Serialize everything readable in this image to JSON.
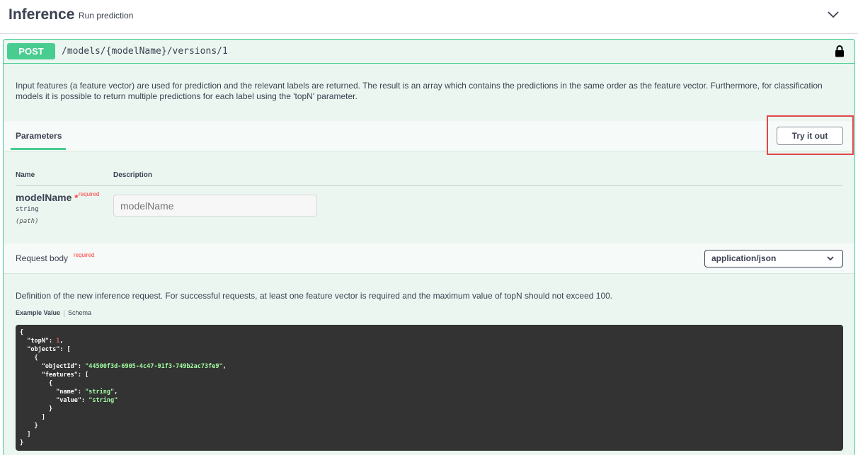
{
  "tag": {
    "title": "Inference",
    "description": "Run prediction"
  },
  "operation": {
    "method": "POST",
    "path": "/models/{modelName}/versions/1",
    "description": "Input features (a feature vector) are used for prediction and the relevant labels are returned. The result is an array which contains the predictions in the same order as the feature vector. Furthermore, for classification models it is possible to return multiple predictions for each label using the 'topN' parameter."
  },
  "parameters": {
    "tab_label": "Parameters",
    "try_label": "Try it out",
    "col_name": "Name",
    "col_description": "Description",
    "items": [
      {
        "name": "modelName",
        "star": "*",
        "required": "required",
        "type": "string",
        "in": "(path)",
        "placeholder": "modelName"
      }
    ]
  },
  "request_body": {
    "title": "Request body",
    "required": "required",
    "content_type": "application/json",
    "description": "Definition of the new inference request. For successful requests, at least one feature vector is required and the maximum value of topN should not exceed 100.",
    "tab_example": "Example Value",
    "tab_schema": "Schema",
    "example": {
      "topN_key": "\"topN\"",
      "topN_value": "1",
      "objects_key": "\"objects\"",
      "objectId_key": "\"objectId\"",
      "objectId_value": "\"44500f3d-6905-4c47-91f3-749b2ac73fe9\"",
      "features_key": "\"features\"",
      "name_key": "\"name\"",
      "name_value": "\"string\"",
      "value_key": "\"value\"",
      "value_value": "\"string\""
    }
  },
  "colors": {
    "post_green": "#49cc90",
    "block_bg": "#ebf6f0",
    "highlight_red": "#e04848",
    "code_bg": "#333333"
  }
}
